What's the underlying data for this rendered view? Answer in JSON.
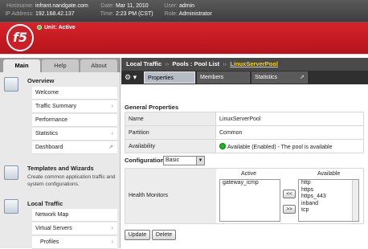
{
  "header": {
    "hostname_label": "Hostname:",
    "hostname": "infrant.nandgate.com",
    "ip_label": "IP Address:",
    "ip": "192.168.42.137",
    "date_label": "Date:",
    "date": "Mar 11, 2010",
    "time_label": "Time:",
    "time": "2:23 PM (CST)",
    "user_label": "User:",
    "user": "admin",
    "role_label": "Role:",
    "role": "Administrator"
  },
  "brand": {
    "logo": "f5",
    "unit_status": "Unit: Active"
  },
  "nav_tabs": [
    "Main",
    "Help",
    "About"
  ],
  "overview": {
    "title": "Overview",
    "items": [
      {
        "label": "Welcome",
        "arrow": ""
      },
      {
        "label": "Traffic Summary",
        "arrow": "›"
      },
      {
        "label": "Performance",
        "arrow": ""
      },
      {
        "label": "Statistics",
        "arrow": "›"
      },
      {
        "label": "Dashboard",
        "arrow": "⇗"
      }
    ]
  },
  "templates": {
    "title": "Templates and Wizards",
    "description": "Create common application traffic and system configurations."
  },
  "local_traffic": {
    "title": "Local Traffic",
    "items": [
      {
        "label": "Network Map",
        "arrow": ""
      },
      {
        "label": "Virtual Servers",
        "arrow": "›"
      },
      {
        "label": "Profiles",
        "arrow": "›"
      }
    ]
  },
  "breadcrumb": {
    "part1": "Local Traffic",
    "sep": "››",
    "part2": "Pools : Pool List",
    "current": "LinuxServerPool"
  },
  "content_tabs": {
    "gear": "⚙ ▾",
    "tabs": [
      "Properties",
      "Members",
      "Statistics"
    ],
    "popout": "⇗"
  },
  "general": {
    "title": "General Properties",
    "rows": [
      {
        "label": "Name",
        "value": "LinuxServerPool"
      },
      {
        "label": "Partition",
        "value": "Common"
      },
      {
        "label": "Availability",
        "value": "Available (Enabled) - The pool is available"
      }
    ]
  },
  "configuration": {
    "label": "Configuration:",
    "value": "Basic"
  },
  "health_monitors": {
    "label": "Health Monitors",
    "active_header": "Active",
    "available_header": "Available",
    "active": [
      "gateway_icmp"
    ],
    "available": [
      "http",
      "https",
      "https_443",
      "inband",
      "tcp"
    ],
    "add_btn": "<<",
    "remove_btn": ">>"
  },
  "actions": {
    "update": "Update",
    "delete": "Delete"
  },
  "colors": {
    "brand_red": "#cc1f28",
    "breadcrumb_current": "#ffd400",
    "status_green": "#1eb51e"
  }
}
